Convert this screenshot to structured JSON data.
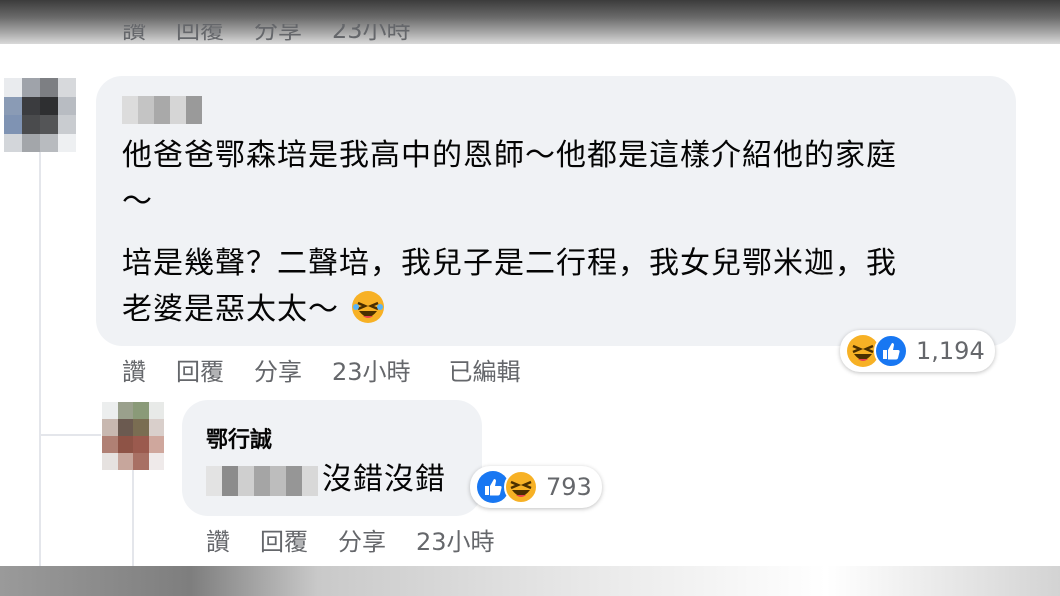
{
  "comment_above": {
    "actions": [
      "讚",
      "回覆",
      "分享"
    ],
    "time": "23小時"
  },
  "comment_main": {
    "text_line1": "他爸爸鄂森培是我高中的恩師～他都是這樣介紹他的家庭",
    "text_line2": "～",
    "text_line3": "培是幾聲？二聲培，我兒子是二行程，我女兒鄂米迦，我",
    "text_line4": "老婆是惡太太～",
    "reactions": [
      "haha-icon",
      "like-icon"
    ],
    "reaction_count": "1,194",
    "actions": [
      "讚",
      "回覆",
      "分享"
    ],
    "time": "23小時",
    "edited": "已編輯"
  },
  "reply": {
    "author": "鄂行誠",
    "text": "沒錯沒錯",
    "reactions": [
      "like-icon",
      "haha-icon"
    ],
    "reaction_count": "793",
    "actions": [
      "讚",
      "回覆",
      "分享"
    ],
    "time": "23小時"
  },
  "colors": {
    "bubble": "#f0f2f5",
    "secondary_text": "#65676b",
    "like_blue": "#1877f2",
    "haha_yellow": "#f7b125"
  }
}
